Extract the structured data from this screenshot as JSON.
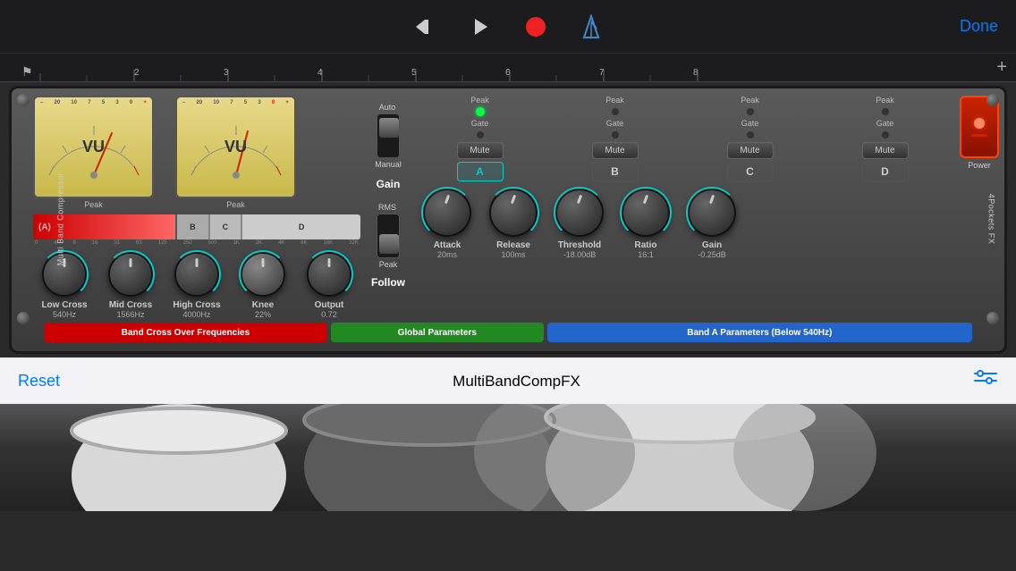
{
  "transport": {
    "done_label": "Done",
    "rewind_icon": "⏮",
    "play_icon": "▶",
    "record_icon": "●",
    "metronome_icon": "🔔",
    "plus_icon": "+"
  },
  "timeline": {
    "markers": [
      "2",
      "3",
      "4",
      "5",
      "6",
      "7",
      "8"
    ]
  },
  "plugin": {
    "side_label_left": "Multi Band Compressor",
    "side_label_right": "4Pockets FX",
    "vu_left_label": "VU",
    "vu_right_label": "VU",
    "vu_peak_label": "Peak",
    "gain_auto_label": "Auto",
    "gain_manual_label": "Manual",
    "gain_label": "Gain",
    "rms_label": "RMS",
    "peak_label": "Peak",
    "follow_label": "Follow",
    "bands": [
      "A",
      "B",
      "C",
      "D"
    ],
    "band_labels": [
      "Peak",
      "Gate",
      "Mute"
    ],
    "band_a_active": true,
    "power_label": "Power",
    "knobs": {
      "low_cross_label": "Low Cross",
      "low_cross_value": "540Hz",
      "mid_cross_label": "Mid Cross",
      "mid_cross_value": "1566Hz",
      "high_cross_label": "High Cross",
      "high_cross_value": "4000Hz",
      "knee_label": "Knee",
      "knee_value": "22%",
      "output_label": "Output",
      "output_value": "0.72",
      "attack_label": "Attack",
      "attack_value": "20ms",
      "release_label": "Release",
      "release_value": "100ms",
      "threshold_label": "Threshold",
      "threshold_value": "-18.00dB",
      "ratio_label": "Ratio",
      "ratio_value": "16:1",
      "gain_knob_label": "Gain",
      "gain_knob_value": "-0.25dB"
    },
    "freq_label_a": "(A)",
    "freq_label_b": "B",
    "freq_label_c": "C",
    "freq_label_d": "D",
    "freq_scale": [
      "0",
      "4",
      "8",
      "16",
      "31",
      "63",
      "125",
      "250",
      "500",
      "1K",
      "2K",
      "4K",
      "8K",
      "16K",
      "32K"
    ],
    "bars": {
      "band_cross_label": "Band Cross Over Frequencies",
      "global_params_label": "Global Parameters",
      "band_a_params_label": "Band A Parameters (Below 540Hz)"
    }
  },
  "toolbar": {
    "reset_label": "Reset",
    "plugin_name": "MultiBandCompFX",
    "settings_icon": "⚙"
  }
}
